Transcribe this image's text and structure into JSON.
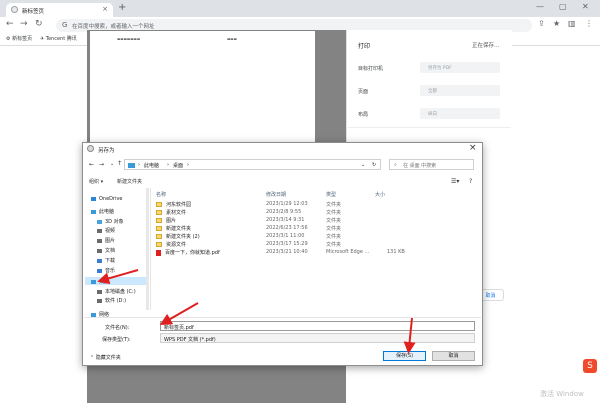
{
  "browser": {
    "tab_title": "新标签页",
    "omnibox_placeholder": "在百度中搜索，或者输入一个网址",
    "bookmarks": [
      "新标签页",
      "Tencent 腾讯"
    ]
  },
  "print_panel": {
    "title": "打印",
    "status": "正在保存...",
    "fields": [
      {
        "label": "目标打印机",
        "value": "另存为 PDF"
      },
      {
        "label": "页面",
        "value": "全部"
      },
      {
        "label": "布局",
        "value": "纵向"
      }
    ],
    "cancel": "取消"
  },
  "dialog": {
    "title": "另存为",
    "path": [
      "此电脑",
      "桌面"
    ],
    "search_placeholder": "在 桌面 中搜索",
    "toolbar": {
      "organize": "组织 ▾",
      "new_folder": "新建文件夹"
    },
    "nav": [
      {
        "label": "OneDrive",
        "color": "#2b88d8"
      },
      {
        "label": "此电脑",
        "color": "#3a9ad9"
      },
      {
        "label": "3D 对象",
        "color": "#4aa3df"
      },
      {
        "label": "视频",
        "color": "#6b6b6b"
      },
      {
        "label": "图片",
        "color": "#6b6b6b"
      },
      {
        "label": "文档",
        "color": "#6b6b6b"
      },
      {
        "label": "下载",
        "color": "#3a7bd5"
      },
      {
        "label": "音乐",
        "color": "#3a7bd5"
      },
      {
        "label": "桌面",
        "color": "#3a9ad9"
      },
      {
        "label": "本地磁盘 (C:)",
        "color": "#6b6b6b"
      },
      {
        "label": "软件 (D:)",
        "color": "#6b6b6b"
      },
      {
        "label": "网络",
        "color": "#3a9ad9"
      }
    ],
    "columns": [
      "名称",
      "修改日期",
      "类型",
      "大小"
    ],
    "rows": [
      {
        "name": "河东软件园",
        "date": "2023/1/29 12:03",
        "type": "文件夹",
        "size": "",
        "icon": "folder"
      },
      {
        "name": "素材文件",
        "date": "2023/2/8 9:55",
        "type": "文件夹",
        "size": "",
        "icon": "folder"
      },
      {
        "name": "图片",
        "date": "2023/3/14 9:31",
        "type": "文件夹",
        "size": "",
        "icon": "folder"
      },
      {
        "name": "新建文件夹",
        "date": "2022/6/23 17:56",
        "type": "文件夹",
        "size": "",
        "icon": "folder"
      },
      {
        "name": "新建文件夹 (2)",
        "date": "2023/3/1 11:00",
        "type": "文件夹",
        "size": "",
        "icon": "folder"
      },
      {
        "name": "资源文件",
        "date": "2023/3/17 15:29",
        "type": "文件夹",
        "size": "",
        "icon": "folder"
      },
      {
        "name": "百度一下，你就知道.pdf",
        "date": "2023/3/21 10:40",
        "type": "Microsoft Edge ...",
        "size": "131 KB",
        "icon": "pdf"
      }
    ],
    "filename_label": "文件名(N):",
    "filename_value": "新标签页.pdf",
    "filetype_label": "保存类型(T):",
    "filetype_value": "WPS PDF 文档 (*.pdf)",
    "hide_folders": "隐藏文件夹",
    "save": "保存(S)",
    "cancel": "取消"
  },
  "watermark": "激活 Window"
}
